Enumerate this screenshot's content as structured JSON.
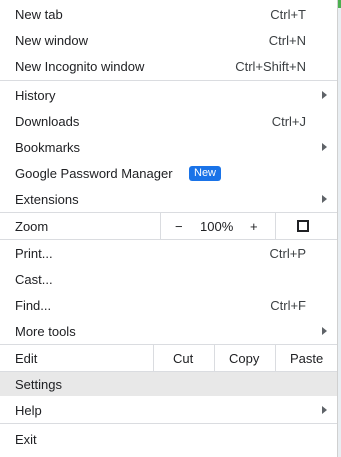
{
  "menu": {
    "new_tab": {
      "label": "New tab",
      "shortcut": "Ctrl+T"
    },
    "new_window": {
      "label": "New window",
      "shortcut": "Ctrl+N"
    },
    "new_incognito": {
      "label": "New Incognito window",
      "shortcut": "Ctrl+Shift+N"
    },
    "history": {
      "label": "History"
    },
    "downloads": {
      "label": "Downloads",
      "shortcut": "Ctrl+J"
    },
    "bookmarks": {
      "label": "Bookmarks"
    },
    "password_manager": {
      "label": "Google Password Manager",
      "badge": "New"
    },
    "extensions": {
      "label": "Extensions"
    },
    "zoom": {
      "label": "Zoom",
      "minus": "−",
      "value": "100%",
      "plus": "+"
    },
    "print": {
      "label": "Print...",
      "shortcut": "Ctrl+P"
    },
    "cast": {
      "label": "Cast..."
    },
    "find": {
      "label": "Find...",
      "shortcut": "Ctrl+F"
    },
    "more_tools": {
      "label": "More tools"
    },
    "edit": {
      "label": "Edit",
      "cut": "Cut",
      "copy": "Copy",
      "paste": "Paste"
    },
    "settings": {
      "label": "Settings"
    },
    "help": {
      "label": "Help"
    },
    "exit": {
      "label": "Exit"
    }
  },
  "colors": {
    "badge_bg": "#1a73e8",
    "highlight": "#e8e8e8",
    "separator": "#dadce0"
  },
  "icons": {
    "submenu": "chevron-right-icon",
    "fullscreen": "fullscreen-icon"
  }
}
